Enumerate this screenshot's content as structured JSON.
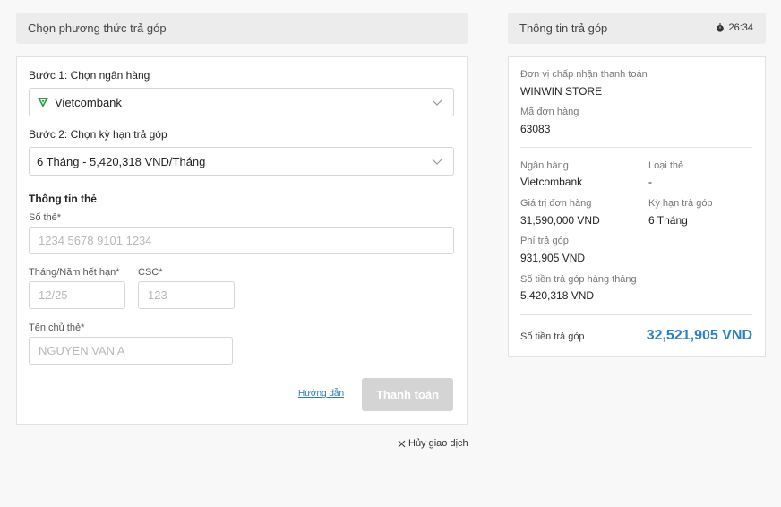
{
  "left": {
    "title": "Chọn phương thức trả góp",
    "step1_label": "Bước 1: Chọn ngân hàng",
    "bank_selected": "Vietcombank",
    "step2_label": "Bước 2: Chọn kỳ hạn trả góp",
    "term_selected": "6 Tháng - 5,420,318 VND/Tháng",
    "card_section_title": "Thông tin thẻ",
    "card_number_label": "Số thẻ*",
    "card_number_placeholder": "1234 5678 9101 1234",
    "expiry_label": "Tháng/Năm hết hạn*",
    "expiry_placeholder": "12/25",
    "csc_label": "CSC*",
    "csc_placeholder": "123",
    "holder_label": "Tên chủ thẻ*",
    "holder_placeholder": "NGUYEN VAN A",
    "guide_link": "Hướng dẫn",
    "pay_button": "Thanh toán",
    "cancel_link": "Hủy giao dịch"
  },
  "right": {
    "title": "Thông tin trả góp",
    "timer": "26:34",
    "merchant_label": "Đơn vị chấp nhận thanh toán",
    "merchant_value": "WINWIN STORE",
    "order_label": "Mã đơn hàng",
    "order_value": "63083",
    "bank_label": "Ngân hàng",
    "bank_value": "Vietcombank",
    "card_type_label": "Loại thẻ",
    "card_type_value": "-",
    "order_amount_label": "Giá trị đơn hàng",
    "order_amount_value": "31,590,000 VND",
    "term_label": "Kỳ hạn trả góp",
    "term_value": "6 Tháng",
    "fee_label": "Phí trả góp",
    "fee_value": "931,905 VND",
    "monthly_label": "Số tiền trả góp hàng tháng",
    "monthly_value": "5,420,318 VND",
    "total_label": "Số tiền trả góp",
    "total_value": "32,521,905 VND"
  },
  "colors": {
    "accent": "#2a82c4",
    "bank_green": "#2e9e4a",
    "button_disabled": "#d4d4d4"
  },
  "icons": {
    "timer": "stopwatch-icon",
    "dropdown": "chevron-down-icon",
    "cancel": "close-icon",
    "bank": "vietcombank-logo-icon"
  }
}
